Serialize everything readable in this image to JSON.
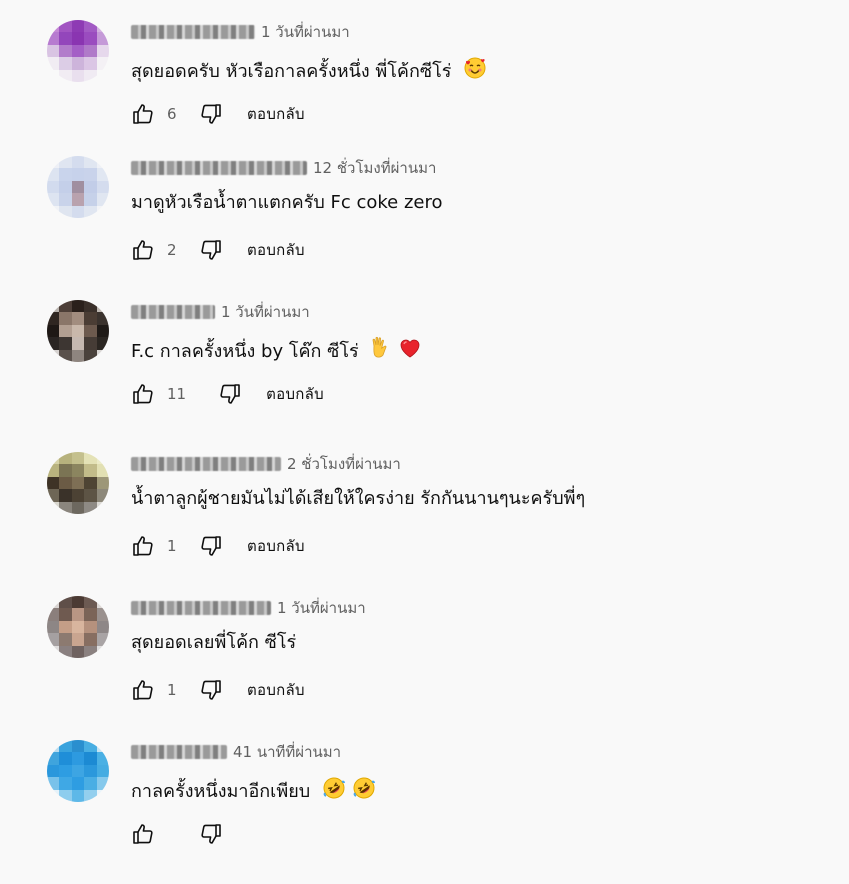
{
  "comments": [
    {
      "author": "Matisse Smartill",
      "time": "1 วันที่ผ่านมา",
      "text": "สุดยอดครับ หัวเรือกาลครั้งหนึ่ง พี่โค้กซีโร่",
      "emojis": [
        "smiling-face-with-hearts"
      ],
      "likes": "6",
      "reply": "ตอบกลับ",
      "avatar_colors": [
        "#c58ad6",
        "#a255c2",
        "#8e3bb4",
        "#a25ac4",
        "#d3b1e0",
        "#b77bd0",
        "#9346bb",
        "#8a35b1",
        "#9a4cbf",
        "#c59ad8",
        "#d9c4e3",
        "#b27ccb",
        "#a45fc6",
        "#b07ac9",
        "#e6d8ec",
        "#f1ecf3",
        "#dccde6",
        "#cdb4db",
        "#dbc6e5",
        "#f4f1f5",
        "#f9f9f9",
        "#f1ecf3",
        "#e9dfee",
        "#f0ebf3",
        "#f9f9f9"
      ]
    },
    {
      "author": "Kritchai Kittisak TV",
      "time": "12 ชั่วโมงที่ผ่านมา",
      "text": "มาดูหัวเรือน้ำตาแตกครับ Fc coke zero",
      "emojis": [],
      "likes": "2",
      "reply": "ตอบกลับ",
      "avatar_colors": [
        "#eef0f6",
        "#dfe5f1",
        "#d4dcee",
        "#e0e6f1",
        "#eff1f6",
        "#dde4f1",
        "#c9d4ec",
        "#c7d2eb",
        "#c9d3eb",
        "#e1e7f2",
        "#d2dbee",
        "#c4cfe9",
        "#a08fa0",
        "#c2cde8",
        "#d4dcee",
        "#dde4f1",
        "#c9d3ea",
        "#b9a2ae",
        "#c6d1e9",
        "#e0e6f1",
        "#f1f3f7",
        "#dfe5f0",
        "#d4dcee",
        "#e0e6f1",
        "#f3f4f7"
      ]
    },
    {
      "author": "Fee spirit",
      "time": "1 วันที่ผ่านมา",
      "text": "F.c กาลครั้งหนึ่ง by โค๊ก ซีโร่",
      "emojis": [
        "vulcan-salute",
        "red-heart"
      ],
      "likes": "11",
      "reply": "ตอบกลับ",
      "avatar_colors": [
        "#b8b2ad",
        "#4d3f38",
        "#2a201b",
        "#3a302a",
        "#bdb6b0",
        "#2f2621",
        "#8a7669",
        "#a28d7f",
        "#4b3d34",
        "#3b332e",
        "#1e1815",
        "#b29f92",
        "#c9b8ab",
        "#6d5a4e",
        "#1f1a17",
        "#2a2523",
        "#3d3632",
        "#c5b8b0",
        "#463c36",
        "#2b2622",
        "#d5d1cf",
        "#5a514c",
        "#8e857f",
        "#4a423c",
        "#d9d6d4"
      ]
    },
    {
      "author": "ChiOpRaK Mahay",
      "time": "2 ชั่วโมงที่ผ่านมา",
      "text": "น้ำตาลูกผู้ชายมันไม่ได้เสียให้ใครง่าย รักกันนานๆนะครับพี่ๆ",
      "emojis": [],
      "likes": "1",
      "reply": "ตอบกลับ",
      "avatar_colors": [
        "#d7d3a8",
        "#b7b27d",
        "#c4c08d",
        "#e4e2b6",
        "#ecebc8",
        "#b9b37e",
        "#7b7454",
        "#8b855f",
        "#c2bc8a",
        "#e2e0b3",
        "#3e3326",
        "#6b5b45",
        "#7e6f55",
        "#4e4434",
        "#9d9778",
        "#6e6656",
        "#3a3229",
        "#4c4234",
        "#5d5445",
        "#8d887a",
        "#d9d7cf",
        "#8a857d",
        "#6d685f",
        "#8e8a84",
        "#dcdad5"
      ]
    },
    {
      "author": "ukTobti nuuritHe",
      "time": "1 วันที่ผ่านมา",
      "text": "สุดยอดเลยพี่โค้ก ซีโร่",
      "emojis": [],
      "likes": "1",
      "reply": "ตอบกลับ",
      "avatar_colors": [
        "#d9d4d2",
        "#5f4f49",
        "#4b3a33",
        "#6c5a52",
        "#ddd8d5",
        "#8b7f7c",
        "#6f5a50",
        "#b99684",
        "#7b6457",
        "#9a918e",
        "#8d8685",
        "#c49e87",
        "#d8b59e",
        "#b5917d",
        "#8e8787",
        "#a5a0a1",
        "#8c7a70",
        "#c9a590",
        "#876e61",
        "#a9a4a5",
        "#dedcdc",
        "#8a8080",
        "#6f6260",
        "#8b8180",
        "#e0dede"
      ]
    },
    {
      "author": "Pimu pung",
      "time": "41 นาทีที่ผ่านมา",
      "text": "กาลครั้งหนึ่งมาอีกเพียบ",
      "emojis": [
        "rolling-on-floor-laughing",
        "rolling-on-floor-laughing"
      ],
      "likes": "",
      "reply": "",
      "avatar_colors": [
        "#b9dcef",
        "#3aa3dd",
        "#2a8fcf",
        "#48aee2",
        "#c6e3f2",
        "#3fa4dd",
        "#1f8ed8",
        "#2d9ae0",
        "#1c8ad3",
        "#4ab0e4",
        "#2a97dc",
        "#2e9de2",
        "#3da5e3",
        "#2b98dc",
        "#45ace2",
        "#79c2ea",
        "#3fa8e5",
        "#2e9de2",
        "#4aaee4",
        "#86c9ec",
        "#e6f2f9",
        "#8ecdee",
        "#5eb8e8",
        "#93cfee",
        "#eaf4fa"
      ]
    }
  ]
}
